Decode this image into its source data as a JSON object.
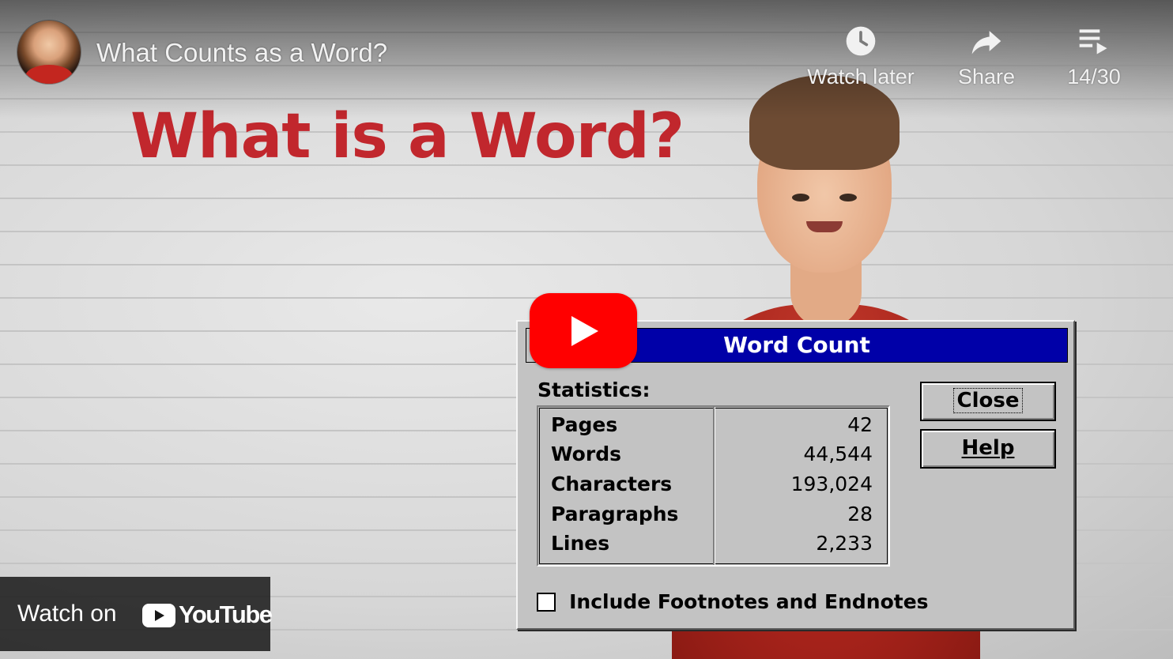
{
  "header": {
    "video_title": "What Counts as a Word?",
    "watch_later_label": "Watch later",
    "share_label": "Share",
    "playlist_position": "14/30"
  },
  "slide": {
    "heading": "What is a Word?"
  },
  "dialog": {
    "title": "Word Count",
    "statistics_label": "Statistics:",
    "stats": [
      {
        "name": "Pages",
        "value": "42"
      },
      {
        "name": "Words",
        "value": "44,544"
      },
      {
        "name": "Characters",
        "value": "193,024"
      },
      {
        "name": "Paragraphs",
        "value": "28"
      },
      {
        "name": "Lines",
        "value": "2,233"
      }
    ],
    "close_label": "Close",
    "help_label": "Help",
    "checkbox_label": "Include Footnotes and Endnotes",
    "checkbox_checked": false
  },
  "footer": {
    "watch_on_label": "Watch on",
    "youtube_wordmark": "YouTube"
  },
  "colors": {
    "heading": "#c1272d",
    "titlebar": "#0000a8",
    "play_button": "#ff0000"
  },
  "icons": {
    "watch_later": "clock-icon",
    "share": "share-arrow-icon",
    "playlist": "playlist-icon",
    "play": "play-icon",
    "youtube": "youtube-logo-icon"
  }
}
